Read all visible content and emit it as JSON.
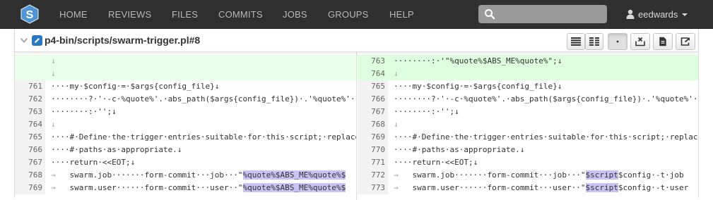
{
  "nav": {
    "items": [
      "HOME",
      "REVIEWS",
      "FILES",
      "COMMITS",
      "JOBS",
      "GROUPS",
      "HELP"
    ],
    "search_placeholder": "",
    "username": "eedwards"
  },
  "file": {
    "name": "p4-bin/scripts/swarm-trigger.pl#8"
  },
  "left_rows": [
    {
      "num": "",
      "text": "↓"
    },
    {
      "num": "",
      "text": "↓"
    },
    {
      "num": "761",
      "text": "····my·$config·=·$args{config_file}↓"
    },
    {
      "num": "762",
      "text": "········?·'·-c·%quote%'.·abs_path($args{config_file})·.'%quote%'·↓"
    },
    {
      "num": "763",
      "text": "········:·'';↓"
    },
    {
      "num": "764",
      "text": "↓"
    },
    {
      "num": "765",
      "text": "····#·Define·the·trigger·entries·suitable·for·this·script;·replace"
    },
    {
      "num": "766",
      "text": "····#·paths·as·appropriate.↓"
    },
    {
      "num": "767",
      "text": "····return·<<EOT;↓"
    },
    {
      "num": "768",
      "pre": "swarm.job·······form-commit···job···\"",
      "hl": "%quote%$ABS_ME%quote%$"
    },
    {
      "num": "769",
      "pre": "swarm.user······form-commit···user··\"",
      "hl": "%quote%$ABS_ME%quote%$"
    }
  ],
  "right_rows": [
    {
      "num": "763",
      "text": "········:·'\"%quote%$ABS_ME%quote%\";↓"
    },
    {
      "num": "764",
      "text": "↓"
    },
    {
      "num": "765",
      "text": "····my·$config·=·$args{config_file}↓"
    },
    {
      "num": "766",
      "text": "········?·'·-c·%quote%'.·abs_path($args{config_file})·.'%quote%'·↓"
    },
    {
      "num": "767",
      "text": "········:·'';↓"
    },
    {
      "num": "768",
      "text": "↓"
    },
    {
      "num": "769",
      "text": "····#·Define·the·trigger·entries·suitable·for·this·script;·replace"
    },
    {
      "num": "770",
      "text": "····#·paths·as·appropriate.↓"
    },
    {
      "num": "771",
      "text": "····return·<<EOT;↓"
    },
    {
      "num": "772",
      "pre": "swarm.job·······form-commit···job···\"",
      "hl": "$script",
      "post": "$config·-t·job"
    },
    {
      "num": "773",
      "pre": "swarm.user······form-commit···user··\"",
      "hl": "$script",
      "post": "$config·-t·user"
    }
  ],
  "tab_marker": "→",
  "colors": {
    "navbar": "#2f2f2f",
    "added": "#ddffdd",
    "highlight": "#c9c3f4",
    "brand": "#2a78c5"
  }
}
